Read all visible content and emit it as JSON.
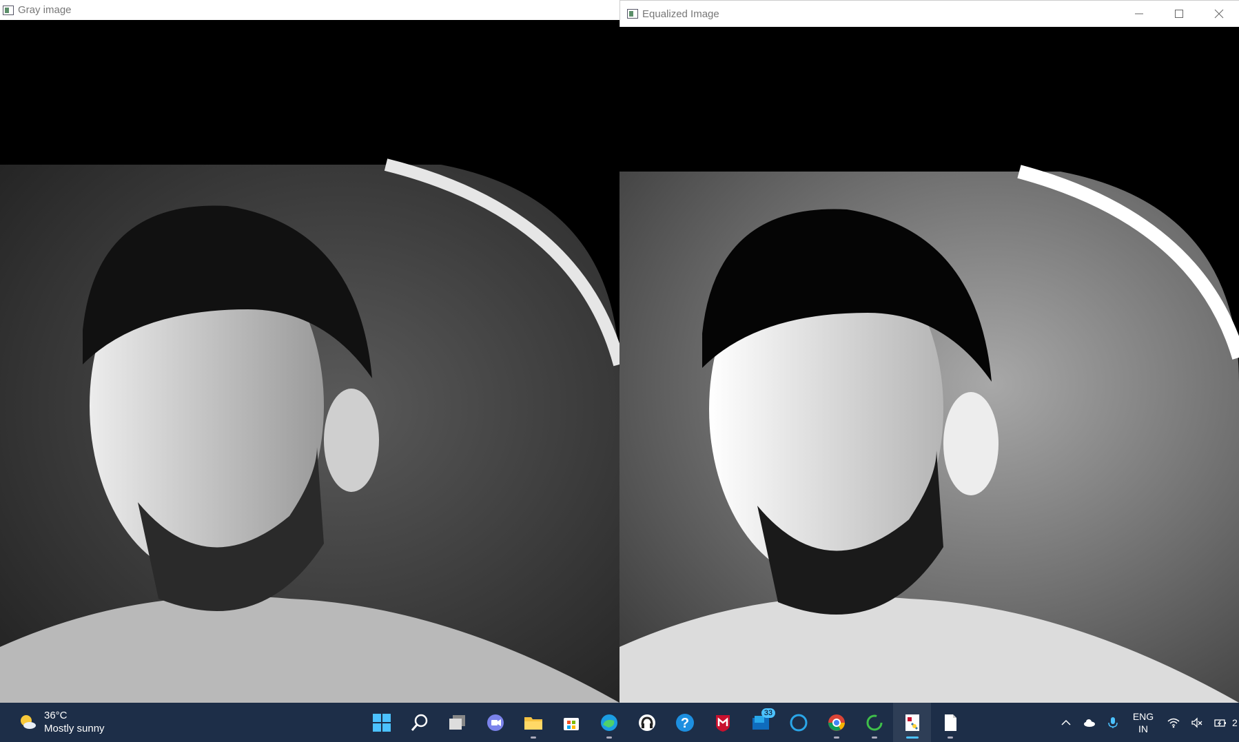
{
  "windows": {
    "gray": {
      "title": "Gray image"
    },
    "equalized": {
      "title": "Equalized Image"
    }
  },
  "taskbar": {
    "weather": {
      "temperature": "36°C",
      "condition": "Mostly sunny"
    },
    "pinned": [
      {
        "name": "start-button",
        "icon": "windows-logo"
      },
      {
        "name": "search-button",
        "icon": "search-icon"
      },
      {
        "name": "task-view-button",
        "icon": "task-view-icon"
      },
      {
        "name": "teams-chat-button",
        "icon": "chat-icon"
      },
      {
        "name": "file-explorer-button",
        "icon": "folder-icon"
      },
      {
        "name": "microsoft-store-button",
        "icon": "store-icon"
      },
      {
        "name": "edge-button",
        "icon": "edge-icon"
      },
      {
        "name": "app-button",
        "icon": "headset-icon"
      },
      {
        "name": "help-button",
        "icon": "help-icon"
      },
      {
        "name": "mcafee-button",
        "icon": "mcafee-icon"
      },
      {
        "name": "mail-button",
        "icon": "mail-icon"
      },
      {
        "name": "cortana-button",
        "icon": "cortana-icon"
      },
      {
        "name": "chrome-button",
        "icon": "chrome-icon"
      },
      {
        "name": "loading-app-button",
        "icon": "ring-icon"
      },
      {
        "name": "python-app-button",
        "icon": "python-icon"
      },
      {
        "name": "notepad-button",
        "icon": "document-icon"
      }
    ],
    "mail_badge": "33",
    "language": {
      "line1": "ENG",
      "line2": "IN"
    },
    "clock_partial": "2"
  }
}
